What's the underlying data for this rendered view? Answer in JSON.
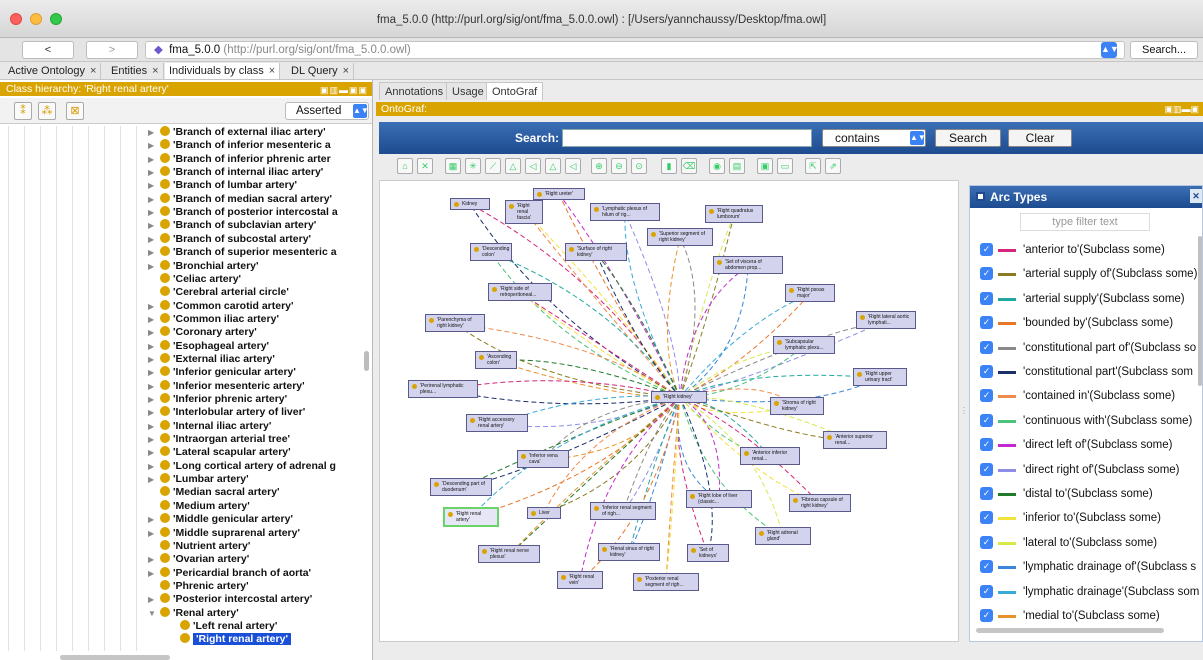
{
  "window": {
    "title": "fma_5.0.0 (http://purl.org/sig/ont/fma_5.0.0.owl)  : [/Users/yannchaussy/Desktop/fma.owl]"
  },
  "addressbar": {
    "back": "<",
    "forward": ">",
    "ontology_name": "fma_5.0.0",
    "ontology_url": "(http://purl.org/sig/ont/fma_5.0.0.owl)",
    "search_button": "Search..."
  },
  "tabs": [
    {
      "label": "Active Ontology"
    },
    {
      "label": "Entities"
    },
    {
      "label": "Individuals by class"
    },
    {
      "label": "DL Query"
    }
  ],
  "class_hierarchy": {
    "header": "Class hierarchy: 'Right renal artery'",
    "mode": "Asserted",
    "items": [
      {
        "label": "'Branch of external iliac artery'",
        "expandable": true
      },
      {
        "label": "'Branch of inferior mesenteric a",
        "expandable": true
      },
      {
        "label": "'Branch of inferior phrenic arter",
        "expandable": true
      },
      {
        "label": "'Branch of internal iliac artery'",
        "expandable": true
      },
      {
        "label": "'Branch of lumbar artery'",
        "expandable": true
      },
      {
        "label": "'Branch of median sacral artery'",
        "expandable": true
      },
      {
        "label": "'Branch of posterior intercostal a",
        "expandable": true
      },
      {
        "label": "'Branch of subclavian artery'",
        "expandable": true
      },
      {
        "label": "'Branch of subcostal artery'",
        "expandable": true
      },
      {
        "label": "'Branch of superior mesenteric a",
        "expandable": true
      },
      {
        "label": "'Bronchial artery'",
        "expandable": true
      },
      {
        "label": "'Celiac artery'",
        "expandable": false
      },
      {
        "label": "'Cerebral arterial circle'",
        "expandable": false
      },
      {
        "label": "'Common carotid artery'",
        "expandable": true
      },
      {
        "label": "'Common iliac artery'",
        "expandable": true
      },
      {
        "label": "'Coronary artery'",
        "expandable": true
      },
      {
        "label": "'Esophageal artery'",
        "expandable": true
      },
      {
        "label": "'External iliac artery'",
        "expandable": true
      },
      {
        "label": "'Inferior genicular artery'",
        "expandable": true
      },
      {
        "label": "'Inferior mesenteric artery'",
        "expandable": true
      },
      {
        "label": "'Inferior phrenic artery'",
        "expandable": true
      },
      {
        "label": "'Interlobular artery of liver'",
        "expandable": true
      },
      {
        "label": "'Internal iliac artery'",
        "expandable": true
      },
      {
        "label": "'Intraorgan arterial tree'",
        "expandable": true
      },
      {
        "label": "'Lateral scapular artery'",
        "expandable": true
      },
      {
        "label": "'Long cortical artery of adrenal g",
        "expandable": true
      },
      {
        "label": "'Lumbar artery'",
        "expandable": true
      },
      {
        "label": "'Median sacral artery'",
        "expandable": false
      },
      {
        "label": "'Medium artery'",
        "expandable": false
      },
      {
        "label": "'Middle genicular artery'",
        "expandable": true
      },
      {
        "label": "'Middle suprarenal artery'",
        "expandable": true
      },
      {
        "label": "'Nutrient artery'",
        "expandable": false
      },
      {
        "label": "'Ovarian artery'",
        "expandable": true
      },
      {
        "label": "'Pericardial branch of aorta'",
        "expandable": true
      },
      {
        "label": "'Phrenic artery'",
        "expandable": false
      },
      {
        "label": "'Posterior intercostal artery'",
        "expandable": true
      },
      {
        "label": "'Renal artery'",
        "expandable": true,
        "expanded": true
      },
      {
        "label": "'Left renal artery'",
        "child": true
      },
      {
        "label": "'Right renal artery'",
        "child": true,
        "selected": true
      }
    ]
  },
  "view_tabs": [
    {
      "label": "Annotations"
    },
    {
      "label": "Usage"
    },
    {
      "label": "OntoGraf"
    }
  ],
  "ontograf": {
    "header": "OntoGraf:",
    "search_label": "Search:",
    "search_value": "",
    "match_mode": "contains",
    "search_button": "Search",
    "clear_button": "Clear",
    "nodes": [
      {
        "label": "Kidney"
      },
      {
        "label": "'Right ureter'"
      },
      {
        "label": "'Right renal fascia'"
      },
      {
        "label": "'Lymphatic plexus of hilum of rig..."
      },
      {
        "label": "'Right quadratus lumborum'"
      },
      {
        "label": "'Superior segment of right kidney'"
      },
      {
        "label": "'Descending colon'"
      },
      {
        "label": "'Surface of right kidney'"
      },
      {
        "label": "'Set of viscera of abdomen prop..."
      },
      {
        "label": "'Right side of retroperitoneal..."
      },
      {
        "label": "'Right psoas major'"
      },
      {
        "label": "'Parenchyma of right kidney'"
      },
      {
        "label": "'Right lateral aortic lymphati..."
      },
      {
        "label": "'Subcapsular lymphatic plexu..."
      },
      {
        "label": "'Ascending colon'"
      },
      {
        "label": "'Right upper urinary tract'"
      },
      {
        "label": "'Perirenal lymphatic plexu..."
      },
      {
        "label": "'Right kidney'"
      },
      {
        "label": "'Stroma of right kidney'"
      },
      {
        "label": "'Right accessory renal artery'"
      },
      {
        "label": "'Anterior superior renal..."
      },
      {
        "label": "'Inferior vena cava'"
      },
      {
        "label": "'Anterior inferior renal..."
      },
      {
        "label": "'Descending part of duodenum'"
      },
      {
        "label": "'Right lobe of liver (classic..."
      },
      {
        "label": "'Fibrous capsule of right kidney'"
      },
      {
        "label": "'Right renal artery'"
      },
      {
        "label": "Liver"
      },
      {
        "label": "'Inferior renal segment of righ..."
      },
      {
        "label": "'Right adrenal gland'"
      },
      {
        "label": "'Right renal nerve plexus'"
      },
      {
        "label": "'Renal sinus of right kidney'"
      },
      {
        "label": "'Set of kidneys'"
      },
      {
        "label": "'Right renal vein'"
      },
      {
        "label": "'Posterior renal segment of righ..."
      }
    ]
  },
  "arc_types": {
    "title": "Arc Types",
    "filter_placeholder": "type filter text",
    "items": [
      {
        "label": "'anterior to'(Subclass some)",
        "color": "#d6247a"
      },
      {
        "label": "'arterial supply of'(Subclass some)",
        "color": "#8a7a20"
      },
      {
        "label": "'arterial supply'(Subclass some)",
        "color": "#20a8a0"
      },
      {
        "label": "'bounded by'(Subclass some)",
        "color": "#e8772a"
      },
      {
        "label": "'constitutional part of'(Subclass so",
        "color": "#8a8a8a"
      },
      {
        "label": "'constitutional part'(Subclass som",
        "color": "#1b2f6b"
      },
      {
        "label": "'contained in'(Subclass some)",
        "color": "#f08a4b"
      },
      {
        "label": "'continuous with'(Subclass some)",
        "color": "#4cc27a"
      },
      {
        "label": "'direct left of'(Subclass some)",
        "color": "#c22ad0"
      },
      {
        "label": "'direct right of'(Subclass some)",
        "color": "#8d8de8"
      },
      {
        "label": "'distal to'(Subclass some)",
        "color": "#1f7a2a"
      },
      {
        "label": "'inferior to'(Subclass some)",
        "color": "#f2e23a"
      },
      {
        "label": "'lateral to'(Subclass some)",
        "color": "#d8e84a"
      },
      {
        "label": "'lymphatic drainage of'(Subclass s",
        "color": "#3a86d8"
      },
      {
        "label": "'lymphatic drainage'(Subclass som",
        "color": "#3aaad8"
      },
      {
        "label": "'medial to'(Subclass some)",
        "color": "#e8932a"
      }
    ]
  },
  "colors": {
    "accent_header": "#d9a300",
    "selection": "#1a4fd8",
    "toolbar_blue": "#2a5aa0"
  }
}
